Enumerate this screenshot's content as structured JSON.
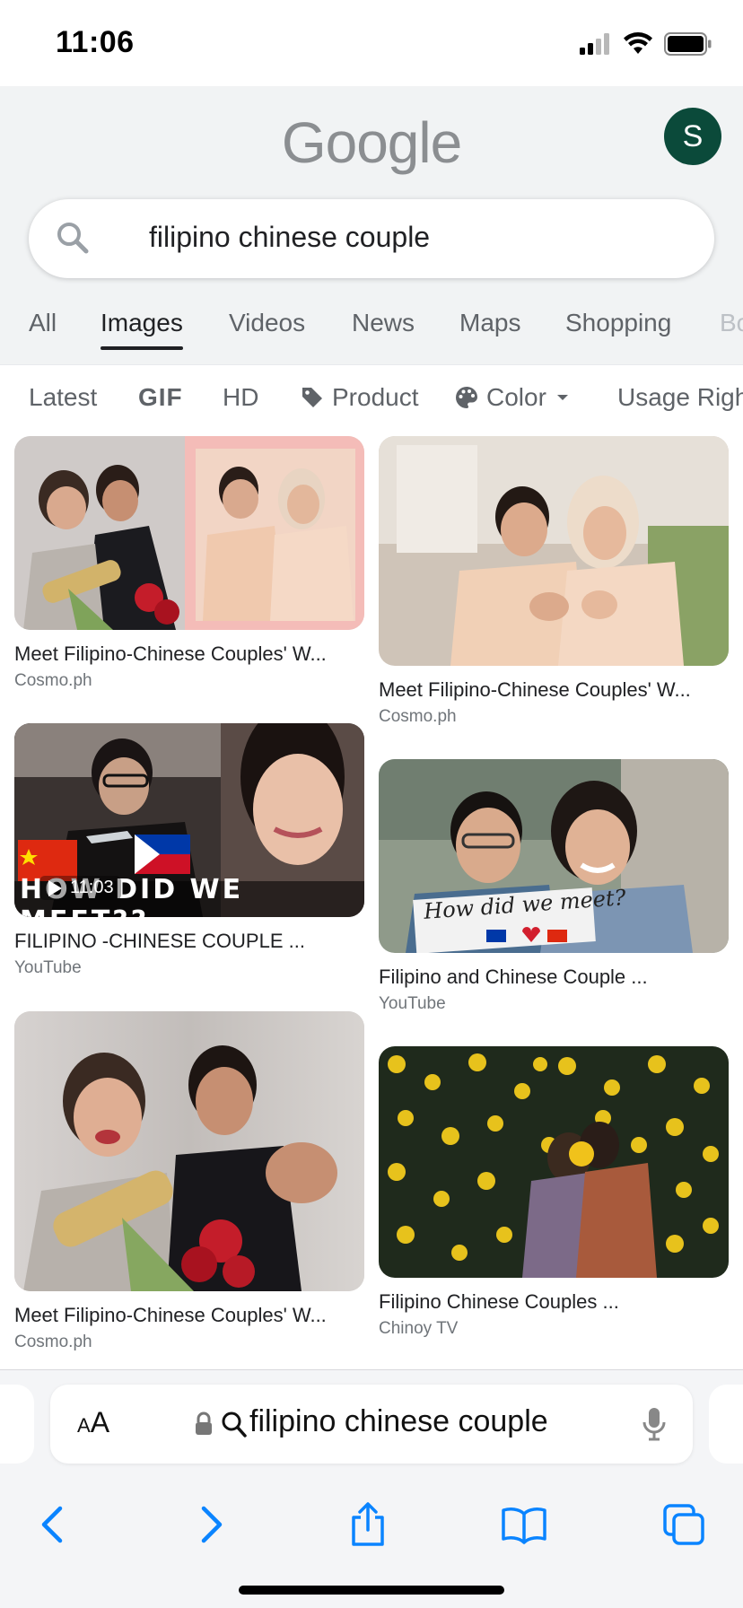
{
  "status": {
    "time": "11:06"
  },
  "header": {
    "logo": "Google",
    "avatar_letter": "S"
  },
  "search": {
    "query": "filipino chinese couple"
  },
  "tabs": [
    {
      "label": "All",
      "active": false
    },
    {
      "label": "Images",
      "active": true
    },
    {
      "label": "Videos",
      "active": false
    },
    {
      "label": "News",
      "active": false
    },
    {
      "label": "Maps",
      "active": false
    },
    {
      "label": "Shopping",
      "active": false
    },
    {
      "label": "Bo",
      "active": false
    }
  ],
  "chips": [
    {
      "label": "Latest"
    },
    {
      "label": "GIF"
    },
    {
      "label": "HD"
    },
    {
      "label": "Product"
    },
    {
      "label": "Color"
    },
    {
      "label": "Usage Righ"
    }
  ],
  "results": [
    {
      "title": "Meet Filipino-Chinese Couples' W...",
      "source": "Cosmo.ph"
    },
    {
      "title": "Meet Filipino-Chinese Couples' W...",
      "source": "Cosmo.ph"
    },
    {
      "title": "FILIPINO -CHINESE COUPLE ...",
      "source": "YouTube",
      "duration": "11:03",
      "overlay_text": "HOW DID WE MEET??"
    },
    {
      "title": "Filipino and Chinese Couple ...",
      "source": "YouTube",
      "overlay_text": "How did we meet?"
    },
    {
      "title": "Meet Filipino-Chinese Couples' W...",
      "source": "Cosmo.ph"
    },
    {
      "title": "Filipino Chinese Couples ...",
      "source": "Chinoy TV"
    }
  ],
  "safari": {
    "aa_label_small": "A",
    "aa_label_big": "A",
    "address_text": "filipino chinese couple"
  },
  "colors": {
    "accent_blue": "#1a73e8",
    "avatar_bg": "#0b4a3a",
    "header_bg": "#f1f3f4",
    "safari_blue": "#0a84ff"
  }
}
